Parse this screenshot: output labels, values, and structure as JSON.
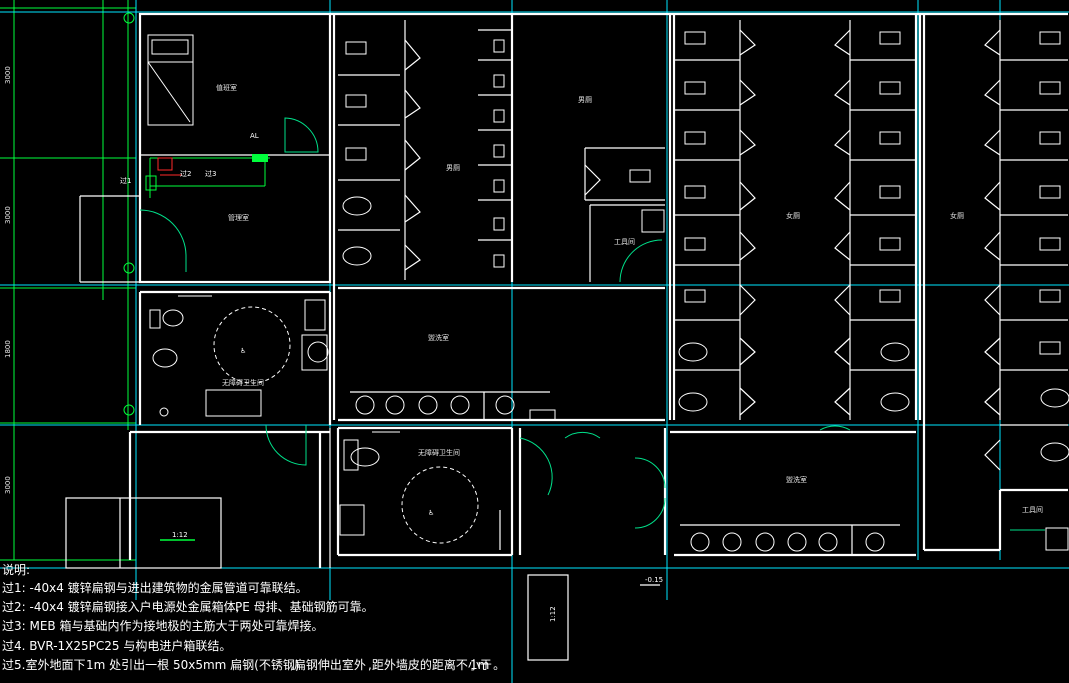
{
  "plan": {
    "rooms": {
      "bedroom": "值班室",
      "duty_room": "管理室",
      "accessible_room_1": "无障碍卫生间",
      "accessible_room_2": "无障碍卫生间",
      "male_wc": "男厕",
      "female_wc_1": "女厕",
      "female_wc_2": "女厕",
      "lobby": "男厕",
      "wash_room_1": "盥洗室",
      "wash_room_2": "盥洗室",
      "tool_room_1": "工具间",
      "tool_room_2": "工具间"
    },
    "dimensions": {
      "left_1": "3000",
      "left_2": "3000",
      "left_3": "1800",
      "left_4": "3000",
      "ramp_slope": "1:12",
      "ramp_slope_2": "1:12",
      "elevation": "-0.15"
    },
    "labels": {
      "al": "AL",
      "ground_1": "过1",
      "ground_2": "过2",
      "ground_3": "过3"
    },
    "notes": {
      "title": "说明:",
      "line1": "过1: -40x4 镀锌扁钢与进出建筑物的金属管道可靠联结。",
      "line2_a": "过2: -40x4 镀锌扁钢接入户电源处金属箱体,",
      "line2_b": "PE 母排、基础钢筋可靠。",
      "line3": "过3: MEB 箱与基础内作为接地极的主筋大于两处可靠焊接。",
      "line4": "过4. BVR-1X25PC25   与构电进户箱联结。",
      "line5_a": "过5.室外地面下",
      "line5_b": "1m 处引出一根  50x5mm  扁钢(不锈钢)",
      "line5_c": ",扁钢伸出室外",
      "line5_d": ",距外墙皮的距离不小于",
      "line5_e": "1m 。"
    },
    "colors": {
      "wall": "#ffffff",
      "axis": "#00e6ff",
      "grid": "#00ff3c",
      "door": "#00e08a",
      "electrical_red": "#ff2a2a"
    }
  }
}
